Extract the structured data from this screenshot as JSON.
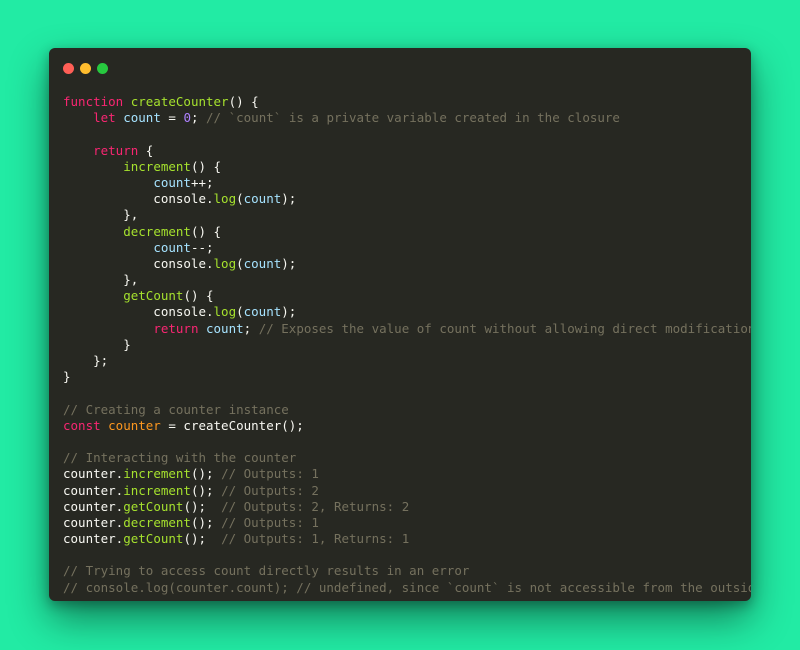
{
  "colors": {
    "background": "#22eba4",
    "editor": "#272822",
    "close": "#ff5f56",
    "minimize": "#ffbd2e",
    "maximize": "#27c93f"
  },
  "window_controls": [
    "close-dot",
    "minimize-dot",
    "maximize-dot"
  ],
  "code_lines": [
    [
      [
        "kw",
        "function "
      ],
      [
        "fn",
        "createCounter"
      ],
      [
        "tx",
        "() {"
      ]
    ],
    [
      [
        "tx",
        "    "
      ],
      [
        "kw",
        "let "
      ],
      [
        "id",
        "count"
      ],
      [
        "tx",
        " = "
      ],
      [
        "num",
        "0"
      ],
      [
        "tx",
        "; "
      ],
      [
        "cm",
        "// `count` is a private variable created in the closure"
      ]
    ],
    [],
    [
      [
        "tx",
        "    "
      ],
      [
        "kw",
        "return"
      ],
      [
        "tx",
        " {"
      ]
    ],
    [
      [
        "tx",
        "        "
      ],
      [
        "fn",
        "increment"
      ],
      [
        "tx",
        "() {"
      ]
    ],
    [
      [
        "tx",
        "            "
      ],
      [
        "id",
        "count"
      ],
      [
        "tx",
        "++;"
      ]
    ],
    [
      [
        "tx",
        "            console."
      ],
      [
        "fn",
        "log"
      ],
      [
        "tx",
        "("
      ],
      [
        "id",
        "count"
      ],
      [
        "tx",
        ");"
      ]
    ],
    [
      [
        "tx",
        "        },"
      ]
    ],
    [
      [
        "tx",
        "        "
      ],
      [
        "fn",
        "decrement"
      ],
      [
        "tx",
        "() {"
      ]
    ],
    [
      [
        "tx",
        "            "
      ],
      [
        "id",
        "count"
      ],
      [
        "tx",
        "--;"
      ]
    ],
    [
      [
        "tx",
        "            console."
      ],
      [
        "fn",
        "log"
      ],
      [
        "tx",
        "("
      ],
      [
        "id",
        "count"
      ],
      [
        "tx",
        ");"
      ]
    ],
    [
      [
        "tx",
        "        },"
      ]
    ],
    [
      [
        "tx",
        "        "
      ],
      [
        "fn",
        "getCount"
      ],
      [
        "tx",
        "() {"
      ]
    ],
    [
      [
        "tx",
        "            console."
      ],
      [
        "fn",
        "log"
      ],
      [
        "tx",
        "("
      ],
      [
        "id",
        "count"
      ],
      [
        "tx",
        ");"
      ]
    ],
    [
      [
        "tx",
        "            "
      ],
      [
        "kw",
        "return "
      ],
      [
        "id",
        "count"
      ],
      [
        "tx",
        "; "
      ],
      [
        "cm",
        "// Exposes the value of count without allowing direct modification"
      ]
    ],
    [
      [
        "tx",
        "        }"
      ]
    ],
    [
      [
        "tx",
        "    };"
      ]
    ],
    [
      [
        "tx",
        "}"
      ]
    ],
    [],
    [
      [
        "cm",
        "// Creating a counter instance"
      ]
    ],
    [
      [
        "kw",
        "const "
      ],
      [
        "var",
        "counter"
      ],
      [
        "tx",
        " = createCounter();"
      ]
    ],
    [],
    [
      [
        "cm",
        "// Interacting with the counter"
      ]
    ],
    [
      [
        "tx",
        "counter."
      ],
      [
        "fn",
        "increment"
      ],
      [
        "tx",
        "(); "
      ],
      [
        "cm",
        "// Outputs: 1"
      ]
    ],
    [
      [
        "tx",
        "counter."
      ],
      [
        "fn",
        "increment"
      ],
      [
        "tx",
        "(); "
      ],
      [
        "cm",
        "// Outputs: 2"
      ]
    ],
    [
      [
        "tx",
        "counter."
      ],
      [
        "fn",
        "getCount"
      ],
      [
        "tx",
        "();  "
      ],
      [
        "cm",
        "// Outputs: 2, Returns: 2"
      ]
    ],
    [
      [
        "tx",
        "counter."
      ],
      [
        "fn",
        "decrement"
      ],
      [
        "tx",
        "(); "
      ],
      [
        "cm",
        "// Outputs: 1"
      ]
    ],
    [
      [
        "tx",
        "counter."
      ],
      [
        "fn",
        "getCount"
      ],
      [
        "tx",
        "();  "
      ],
      [
        "cm",
        "// Outputs: 1, Returns: 1"
      ]
    ],
    [],
    [
      [
        "cm",
        "// Trying to access count directly results in an error"
      ]
    ],
    [
      [
        "cm",
        "// console.log(counter.count); // undefined, since `count` is not accessible from the outside"
      ]
    ]
  ]
}
